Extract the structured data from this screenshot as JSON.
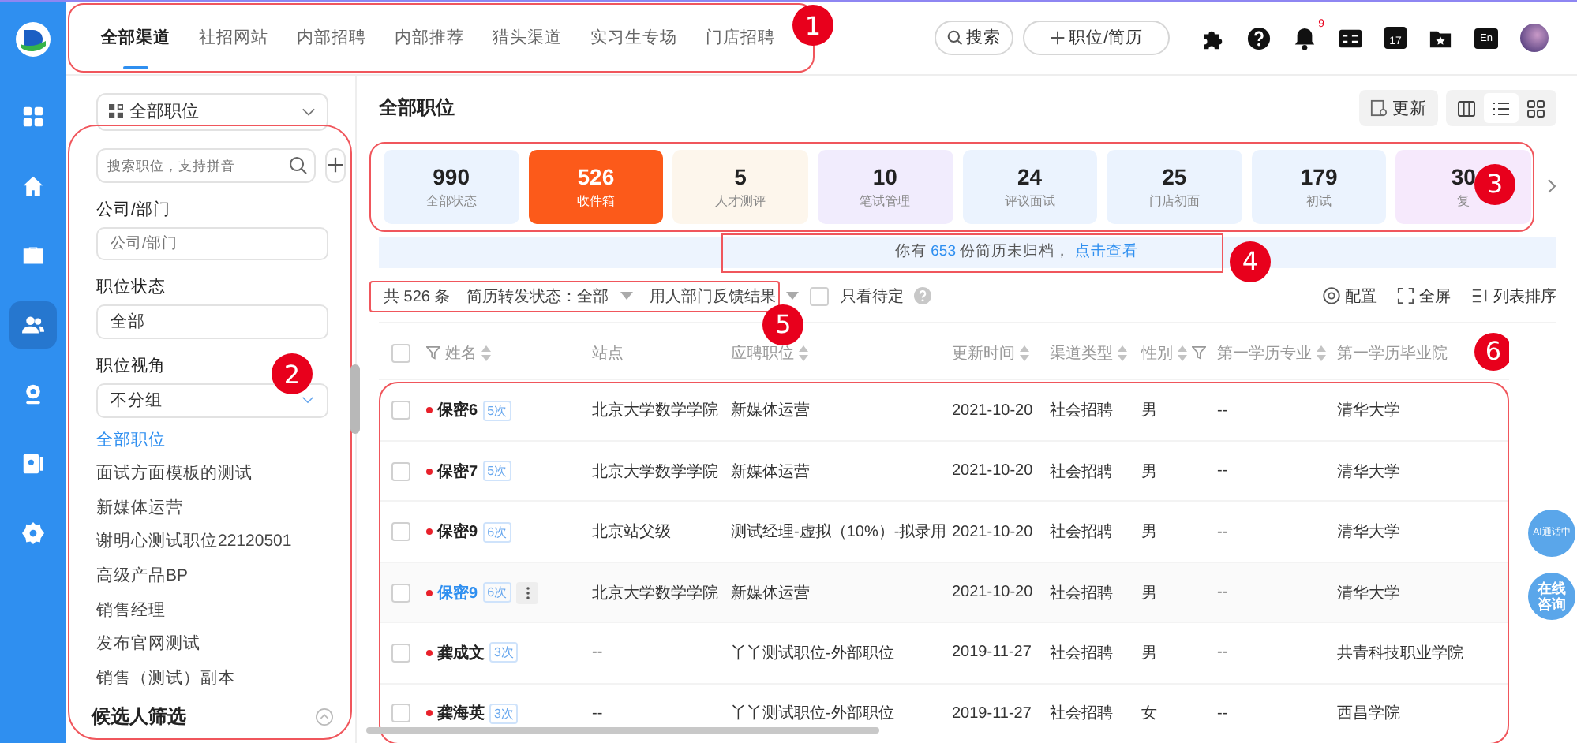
{
  "nav_rail": {
    "items": [
      {
        "selected": false
      },
      {
        "selected": false
      },
      {
        "selected": false
      },
      {
        "selected": true
      },
      {
        "selected": false
      },
      {
        "selected": false
      },
      {
        "selected": false
      }
    ]
  },
  "channel_tabs": {
    "callout": "1",
    "items": [
      {
        "label": "全部渠道",
        "selected": true
      },
      {
        "label": "社招网站",
        "selected": false
      },
      {
        "label": "内部招聘",
        "selected": false
      },
      {
        "label": "内部推荐",
        "selected": false
      },
      {
        "label": "猎头渠道",
        "selected": false
      },
      {
        "label": "实习生专场",
        "selected": false
      },
      {
        "label": "门店招聘",
        "selected": false
      }
    ]
  },
  "top_actions": {
    "search_label": "搜索",
    "create_label": "职位/简历",
    "notification_count": "9",
    "calendar_date": "17",
    "language": "En"
  },
  "left_panel": {
    "callout": "2",
    "scope_select": "全部职位",
    "search_placeholder": "搜索职位，支持拼音",
    "fields": [
      {
        "label": "公司/部门",
        "kind": "input",
        "placeholder": "公司/部门"
      },
      {
        "label": "职位状态",
        "kind": "select",
        "value": "全部"
      },
      {
        "label": "职位视角",
        "kind": "dropdown",
        "value": "不分组"
      }
    ],
    "positions": [
      {
        "label": "全部职位",
        "selected": true
      },
      {
        "label": "面试方面模板的测试",
        "selected": false
      },
      {
        "label": "新媒体运营",
        "selected": false
      },
      {
        "label": "谢明心测试职位22120501",
        "selected": false
      },
      {
        "label": "高级产品BP",
        "selected": false
      },
      {
        "label": "销售经理",
        "selected": false
      },
      {
        "label": "发布官网测试",
        "selected": false
      },
      {
        "label": "销售（测试）副本",
        "selected": false
      }
    ],
    "footer": "候选人筛选"
  },
  "main": {
    "title": "全部职位",
    "refresh_label": "更新",
    "view_modes": [
      {
        "selected": false
      },
      {
        "selected": true
      },
      {
        "selected": false
      }
    ]
  },
  "stats": {
    "callout": "3",
    "cards": [
      {
        "value": "990",
        "label": "全部状态",
        "color": "#ebf3fe",
        "selected": false
      },
      {
        "value": "526",
        "label": "收件箱",
        "color": "#fc5a1a",
        "selected": true
      },
      {
        "value": "5",
        "label": "人才测评",
        "color": "#fdf6ec",
        "selected": false
      },
      {
        "value": "10",
        "label": "笔试管理",
        "color": "#f1ecfd",
        "selected": false
      },
      {
        "value": "24",
        "label": "评议面试",
        "color": "#ebf3fe",
        "selected": false
      },
      {
        "value": "25",
        "label": "门店初面",
        "color": "#ebf3fe",
        "selected": false
      },
      {
        "value": "179",
        "label": "初试",
        "color": "#ebf3fe",
        "selected": false
      },
      {
        "value": "30",
        "label": "复",
        "color": "#f6e9fc",
        "selected": false
      }
    ]
  },
  "notice": {
    "callout": "4",
    "prefix": "你有",
    "count": "653",
    "suffix": "份简历未归档，",
    "link": "点击查看"
  },
  "filters": {
    "callout": "5",
    "total": "共 526 条",
    "forward_status": "简历转发状态：全部",
    "feedback": "用人部门反馈结果",
    "pending_only": {
      "label": "只看待定",
      "checked": false
    },
    "tools": [
      "配置",
      "全屏",
      "列表排序"
    ]
  },
  "table": {
    "callout": "6",
    "all_checked": false,
    "columns": [
      {
        "label": "姓名",
        "sortable": true,
        "filterable": true
      },
      {
        "label": "站点",
        "sortable": false,
        "filterable": false
      },
      {
        "label": "应聘职位",
        "sortable": true,
        "filterable": false
      },
      {
        "label": "更新时间",
        "sortable": true,
        "filterable": false
      },
      {
        "label": "渠道类型",
        "sortable": true,
        "filterable": false
      },
      {
        "label": "性别",
        "sortable": true,
        "filterable": true
      },
      {
        "label": "第一学历专业",
        "sortable": true,
        "filterable": false
      },
      {
        "label": "第一学历毕业院"
      }
    ],
    "rows": [
      {
        "count": "5次",
        "checked": false,
        "highlighted": false,
        "cells": [
          "保密6",
          "北京大学数学学院",
          "新媒体运营",
          "2021-10-20",
          "社会招聘",
          "男",
          "--",
          "清华大学"
        ]
      },
      {
        "count": "5次",
        "checked": false,
        "highlighted": false,
        "cells": [
          "保密7",
          "北京大学数学学院",
          "新媒体运营",
          "2021-10-20",
          "社会招聘",
          "男",
          "--",
          "清华大学"
        ]
      },
      {
        "count": "6次",
        "checked": false,
        "highlighted": false,
        "cells": [
          "保密9",
          "北京站父级",
          "测试经理-虚拟（10%）-拟录用",
          "2021-10-20",
          "社会招聘",
          "男",
          "--",
          "清华大学"
        ]
      },
      {
        "count": "6次",
        "checked": false,
        "highlighted": true,
        "cells": [
          "保密9",
          "北京大学数学学院",
          "新媒体运营",
          "2021-10-20",
          "社会招聘",
          "男",
          "--",
          "清华大学"
        ]
      },
      {
        "count": "3次",
        "checked": false,
        "highlighted": false,
        "cells": [
          "龚成文",
          "--",
          "丫丫测试职位-外部职位",
          "2019-11-27",
          "社会招聘",
          "男",
          "--",
          "共青科技职业学院"
        ]
      },
      {
        "count": "3次",
        "checked": false,
        "highlighted": false,
        "cells": [
          "龚海英",
          "--",
          "丫丫测试职位-外部职位",
          "2019-11-27",
          "社会招聘",
          "女",
          "--",
          "西昌学院"
        ]
      }
    ]
  },
  "floating": [
    "AI通话中",
    "在线咨询"
  ]
}
